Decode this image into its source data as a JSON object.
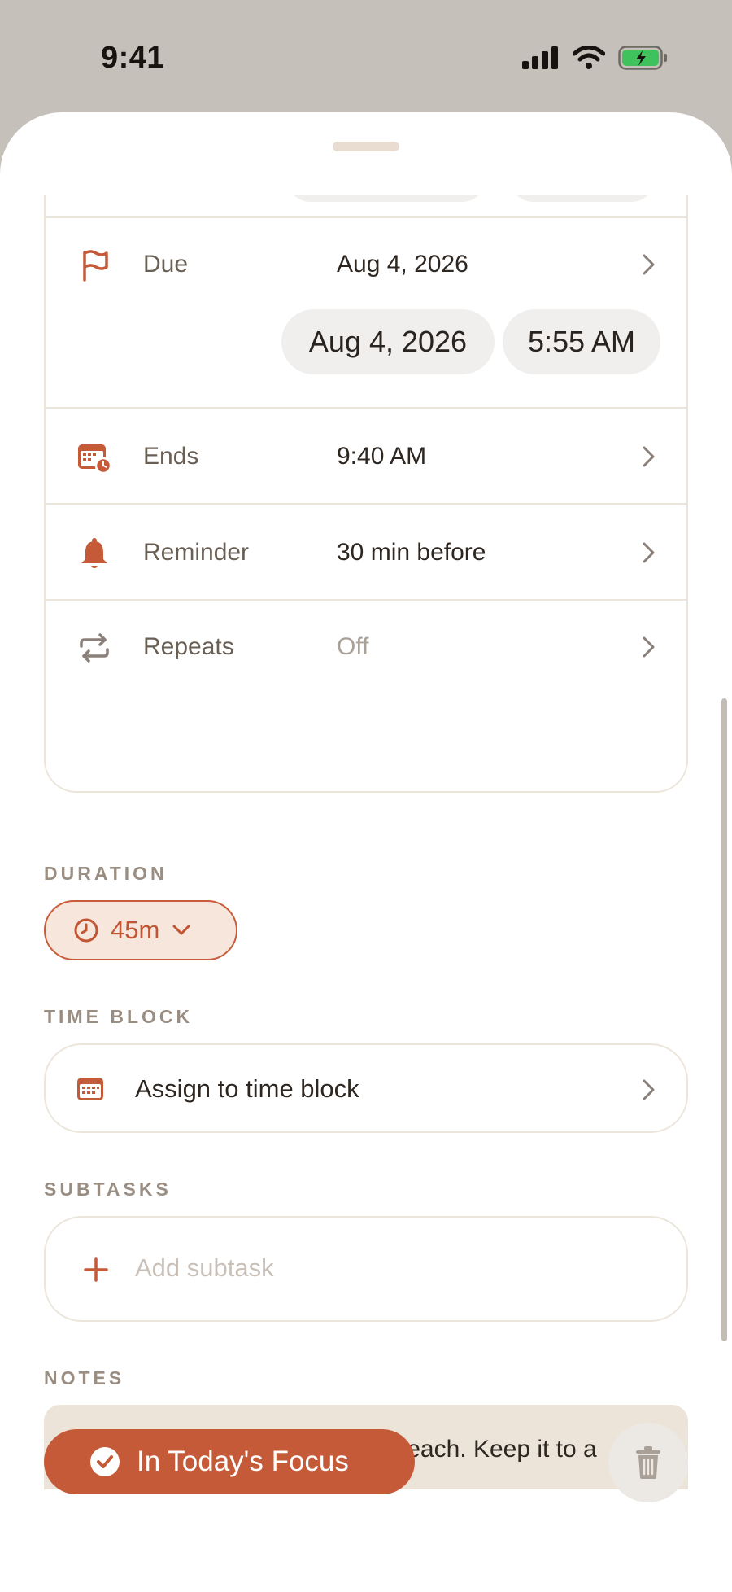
{
  "status_bar": {
    "time": "9:41"
  },
  "rows": [
    {
      "label": "Due",
      "value": "Aug 4, 2026",
      "icon": "flag-icon"
    },
    {
      "label": "Ends",
      "value": "9:40 AM",
      "icon": "calendar-clock-icon"
    },
    {
      "label": "Reminder",
      "value": "30 min before",
      "icon": "bell-icon"
    },
    {
      "label": "Repeats",
      "value": "Off",
      "icon": "repeat-icon"
    }
  ],
  "due_picker": {
    "date": "Aug 4, 2026",
    "time": "5:55 AM"
  },
  "duration": {
    "label": "DURATION",
    "value": "45m"
  },
  "time_block": {
    "label": "TIME BLOCK",
    "action": "Assign to time block"
  },
  "subtasks": {
    "label": "SUBTASKS",
    "placeholder": "Add subtask"
  },
  "notes": {
    "label": "NOTES",
    "text": "Three outcomes, one decision each. Keep it to a single page."
  },
  "footer": {
    "focus_label": "In Today's Focus"
  },
  "colors": {
    "accent": "#c55a38",
    "accent_soft": "#f6e6db",
    "notes_bg": "#ece4d9",
    "backdrop": "#c5c0b9"
  }
}
